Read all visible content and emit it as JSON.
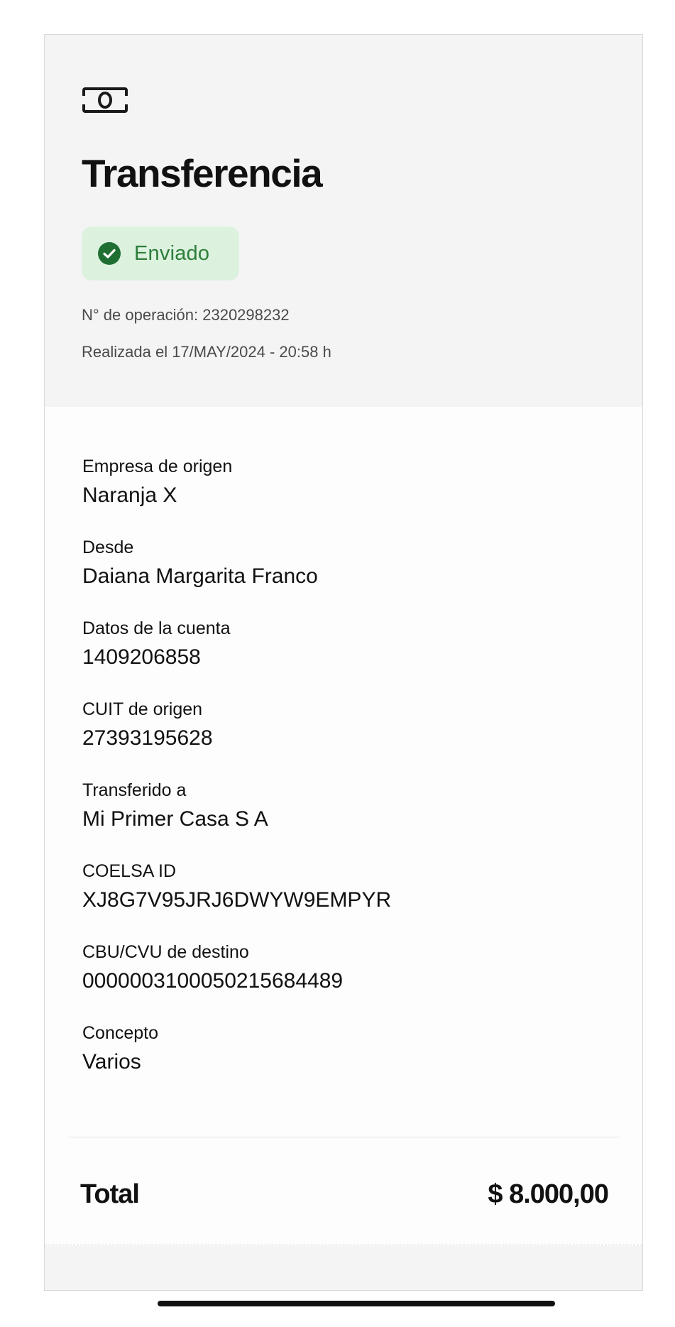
{
  "header": {
    "icon": "banknote-icon",
    "title": "Transferencia",
    "status": {
      "label": "Enviado",
      "icon": "check-circle-icon",
      "color": "#2e7d3a",
      "background": "#dcf2df"
    },
    "operation_number": "N° de operación: 2320298232",
    "performed_at": "Realizada el 17/MAY/2024 - 20:58 h"
  },
  "details": [
    {
      "label": "Empresa de origen",
      "value": "Naranja X"
    },
    {
      "label": "Desde",
      "value": "Daiana Margarita Franco"
    },
    {
      "label": "Datos de la cuenta",
      "value": "1409206858"
    },
    {
      "label": "CUIT de origen",
      "value": "27393195628"
    },
    {
      "label": "Transferido a",
      "value": "Mi Primer Casa S A"
    },
    {
      "label": "COELSA ID",
      "value": "XJ8G7V95JRJ6DWYW9EMPYR"
    },
    {
      "label": "CBU/CVU de destino",
      "value": "0000003100050215684489"
    },
    {
      "label": "Concepto",
      "value": "Varios"
    }
  ],
  "total": {
    "label": "Total",
    "amount": "$ 8.000,00"
  }
}
